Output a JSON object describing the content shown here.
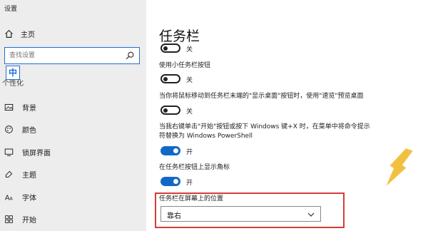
{
  "window": {
    "title": "设置"
  },
  "sidebar": {
    "home_label": "主页",
    "search_placeholder": "查找设置",
    "ime_indicator": "中",
    "section_title_partial": "个性化",
    "items": [
      {
        "label": "背景",
        "icon": "image-icon"
      },
      {
        "label": "颜色",
        "icon": "palette-icon"
      },
      {
        "label": "锁屏界面",
        "icon": "lock-screen-icon"
      },
      {
        "label": "主题",
        "icon": "theme-icon"
      },
      {
        "label": "字体",
        "icon": "font-icon"
      },
      {
        "label": "开始",
        "icon": "start-icon"
      }
    ]
  },
  "main": {
    "title": "任务栏",
    "settings": [
      {
        "label": "",
        "state": "关",
        "on": false
      },
      {
        "label": "使用小任务栏按钮",
        "state": "关",
        "on": false
      },
      {
        "label": "当你将鼠标移动到任务栏末端的\"显示桌面\"按钮时，使用\"速览\"预览桌面",
        "state": "关",
        "on": false
      },
      {
        "label": "当我右键单击\"开始\"按钮或按下 Windows 键+X 时，在菜单中将命令提示符替换为 Windows PowerShell",
        "state": "开",
        "on": true
      },
      {
        "label": "在任务栏按钮上显示角标",
        "state": "开",
        "on": true
      }
    ],
    "position_label": "任务栏在屏幕上的位置",
    "position_value": "靠右"
  },
  "colors": {
    "accent": "#1368c7",
    "highlight": "#d93a3a",
    "arrow": "#f2c040"
  }
}
